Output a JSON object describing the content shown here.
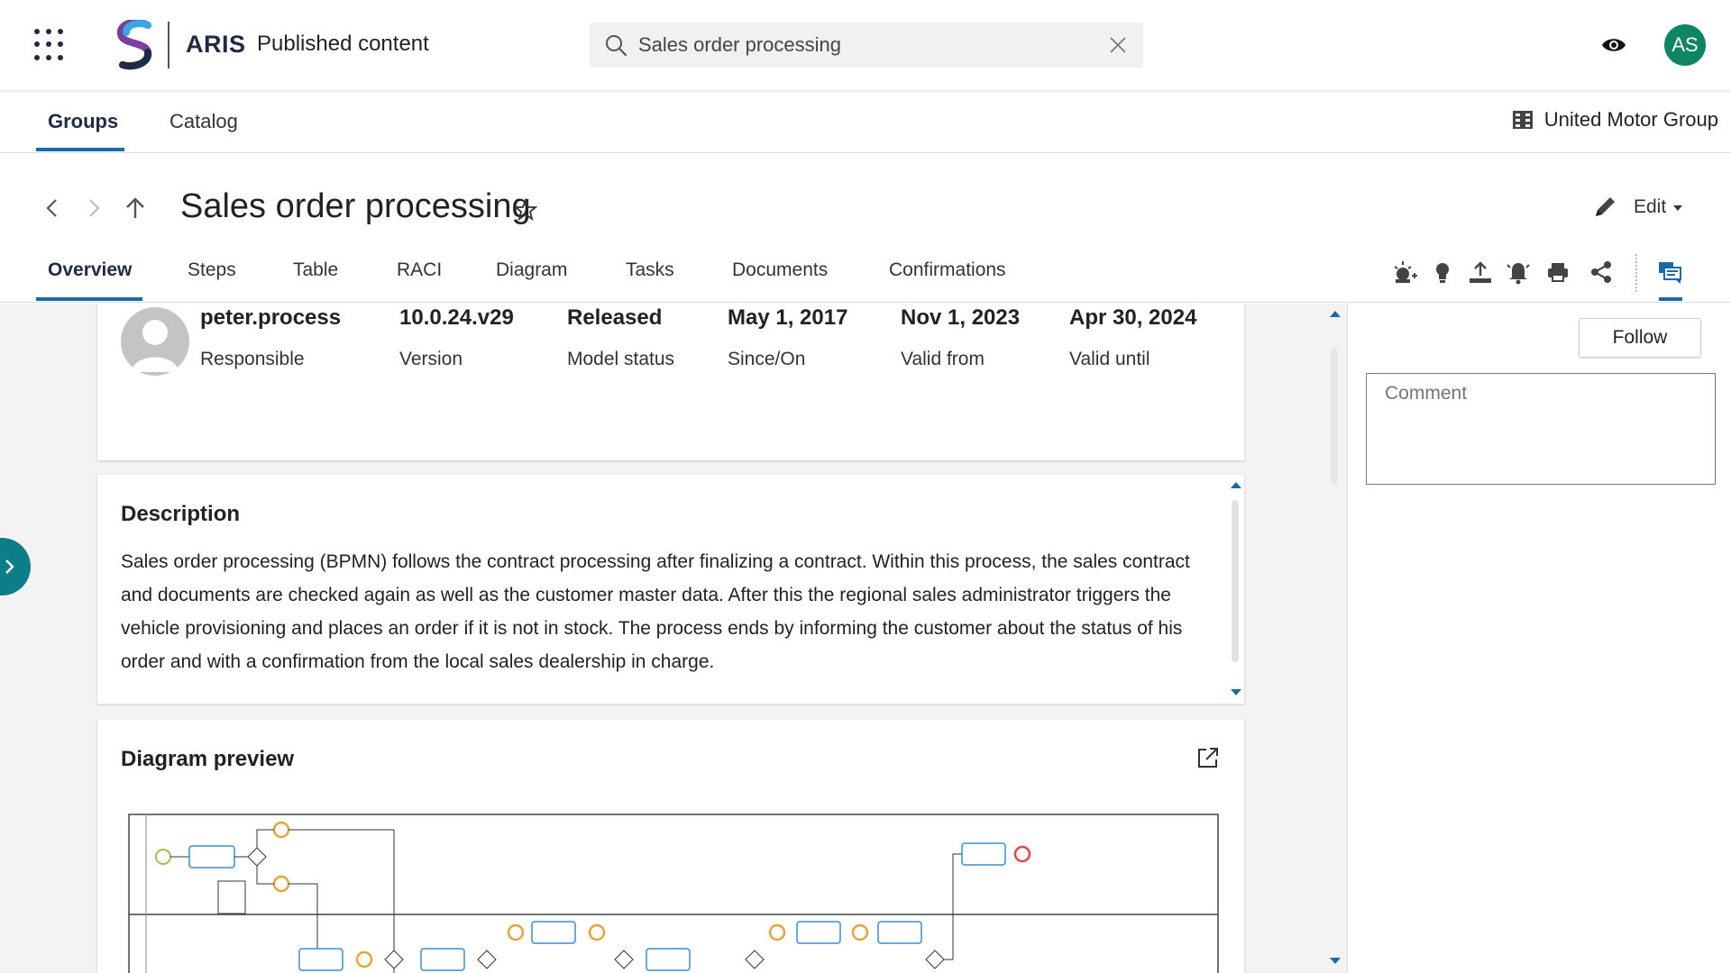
{
  "header": {
    "brand": "ARIS",
    "product": "Published content",
    "search_value": "Sales order processing",
    "user_initials": "AS",
    "accent_color": "#0f8563"
  },
  "subnav": {
    "items": [
      {
        "label": "Groups",
        "active": true
      },
      {
        "label": "Catalog",
        "active": false
      }
    ],
    "organization": "United Motor Group"
  },
  "page": {
    "title": "Sales order processing",
    "edit_label": "Edit",
    "tabs": [
      {
        "label": "Overview",
        "active": true
      },
      {
        "label": "Steps"
      },
      {
        "label": "Table"
      },
      {
        "label": "RACI"
      },
      {
        "label": "Diagram"
      },
      {
        "label": "Tasks"
      },
      {
        "label": "Documents"
      },
      {
        "label": "Confirmations"
      }
    ],
    "toolbar_icons": [
      "improvement-icon",
      "idea-icon",
      "upload-icon",
      "notification-icon",
      "print-icon",
      "share-icon",
      "comments-icon"
    ]
  },
  "meta": [
    {
      "value": "peter.process",
      "label": "Responsible"
    },
    {
      "value": "10.0.24.v29",
      "label": "Version"
    },
    {
      "value": "Released",
      "label": "Model status"
    },
    {
      "value": "May 1, 2017",
      "label": "Since/On"
    },
    {
      "value": "Nov 1, 2023",
      "label": "Valid from"
    },
    {
      "value": "Apr 30, 2024",
      "label": "Valid until"
    }
  ],
  "description": {
    "title": "Description",
    "text": "Sales order processing (BPMN) follows the contract processing after finalizing a contract. Within this process, the sales contract and documents are checked again as well as the customer master data. After this the regional sales administrator triggers the vehicle provisioning and places an order if it is not in stock. The process ends by informing the customer about the status of his order and with a confirmation from the local sales dealership in charge."
  },
  "diagram": {
    "title": "Diagram preview"
  },
  "right_panel": {
    "follow_label": "Follow",
    "comment_placeholder": "Comment"
  }
}
